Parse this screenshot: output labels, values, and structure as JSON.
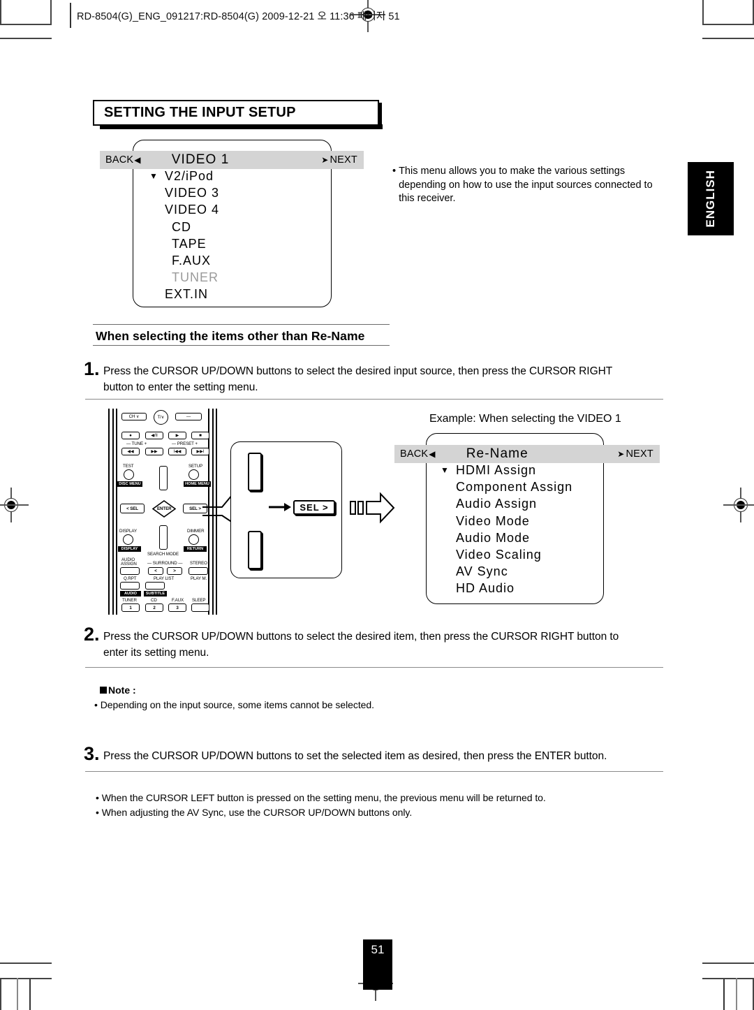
{
  "print_header": {
    "text": "RD-8504(G)_ENG_091217:RD-8504(G)   2009-12-21   오      11:36   페이지 51"
  },
  "section": {
    "title": "SETTING THE INPUT SETUP"
  },
  "language_tab": {
    "label": "ENGLISH"
  },
  "page_number": "51",
  "osd_menu_1": {
    "back_label": "BACK",
    "back_arrow": "◀",
    "next_label": "NEXT",
    "next_arrow": "➤",
    "title": "VIDEO 1",
    "caret": "▼",
    "items": [
      {
        "label": "V2/iPod",
        "dim": false,
        "caret": true
      },
      {
        "label": "VIDEO 3",
        "dim": false,
        "caret": false
      },
      {
        "label": "VIDEO 4",
        "dim": false,
        "caret": false
      },
      {
        "label": "CD",
        "dim": false,
        "caret": false
      },
      {
        "label": "TAPE",
        "dim": false,
        "caret": false
      },
      {
        "label": "F.AUX",
        "dim": false,
        "caret": false
      },
      {
        "label": "TUNER",
        "dim": true,
        "caret": false
      },
      {
        "label": "EXT.IN",
        "dim": false,
        "caret": false
      }
    ]
  },
  "intro_note": {
    "bullet": "•",
    "lines": [
      "This menu allows you to make the various settings",
      "depending on how to use the input sources connected to",
      "this receiver."
    ]
  },
  "subheading": {
    "text": "When selecting the items other than Re-Name"
  },
  "steps": [
    {
      "number": "1.",
      "lines": [
        "Press the CURSOR UP/DOWN buttons to select the desired input source, then press the CURSOR RIGHT",
        "button to enter the setting menu."
      ]
    },
    {
      "number": "2.",
      "lines": [
        "Press the CURSOR UP/DOWN buttons to select the desired item, then press the CURSOR RIGHT button to",
        "enter its setting menu."
      ]
    },
    {
      "number": "3.",
      "lines": [
        "Press the CURSOR UP/DOWN buttons to set the selected item as desired, then press the ENTER button."
      ]
    }
  ],
  "note": {
    "title": "Note :",
    "bullets": [
      "• Depending on the input source, some items cannot be selected."
    ]
  },
  "final_bullets": [
    "• When the CURSOR LEFT button is pressed on the setting menu, the previous menu will be returned to.",
    "• When adjusting the AV Sync, use the CURSOR UP/DOWN buttons only."
  ],
  "example_caption": {
    "text": "Example: When selecting the VIDEO 1"
  },
  "osd_menu_2": {
    "back_label": "BACK",
    "back_arrow": "◀",
    "next_label": "NEXT",
    "next_arrow": "➤",
    "title": "Re-Name",
    "caret": "▼",
    "items": [
      {
        "label": "HDMI Assign",
        "caret": true
      },
      {
        "label": "Component Assign",
        "caret": false
      },
      {
        "label": "Audio Assign",
        "caret": false
      },
      {
        "label": "Video Mode",
        "caret": false
      },
      {
        "label": "Audio Mode",
        "caret": false
      },
      {
        "label": "Video Scaling",
        "caret": false
      },
      {
        "label": "AV Sync",
        "caret": false
      },
      {
        "label": "HD Audio",
        "caret": false
      }
    ]
  },
  "callout": {
    "sel_button_label": "SEL >"
  },
  "remote": {
    "keys": {
      "ch": "CH ∨",
      "tv": "T/∨",
      "minus": "—",
      "record": "●",
      "pause": "◀/II",
      "play": "▶",
      "stop": "■",
      "tune": "— TUNE  +",
      "preset": "— PRESET +",
      "rew": "◀◀",
      "ff": "▶▶",
      "prev": "I◀◀",
      "next": "▶▶I",
      "test": "TEST",
      "setup": "SETUP",
      "disc_menu": "DISC MENU",
      "home_menu": "HOME MENU",
      "sel_left": "< SEL",
      "enter": "ENTER",
      "sel_right": "SEL >",
      "display": "DISPLAY",
      "dimmer": "DIMMER",
      "display_inv": "DISPLAY",
      "return_inv": "RETURN",
      "search_mode": "SEARCH MODE",
      "audio_assign": "AUDIO\nASSIGN",
      "audio_assign_l1": "AUDIO",
      "audio_assign_l2": "ASSIGN",
      "surround": "—  SURROUND  —",
      "stereo": "STEREO",
      "surr_left": "<",
      "surr_right": ">",
      "q_rpt": "Q.RPT",
      "play_list": "PLAY LIST",
      "play_m": "PLAY M.",
      "audio_inv": "AUDIO",
      "subtitle_inv": "SUBTITLE",
      "tuner": "TUNER",
      "cd": "CD",
      "faux": "F.AUX",
      "sleep": "SLEEP",
      "num1": "1",
      "num2": "2",
      "num3": "3"
    }
  }
}
